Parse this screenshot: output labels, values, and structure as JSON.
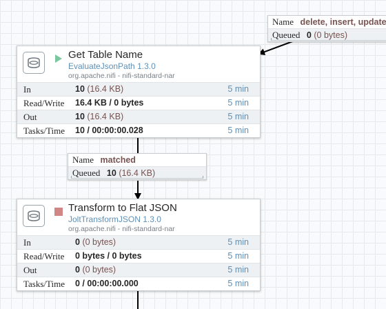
{
  "connections": [
    {
      "name_label": "Name",
      "name": "delete, insert, update",
      "queued_label": "Queued",
      "queued_count": "0",
      "queued_bytes": "(0 bytes)"
    },
    {
      "name_label": "Name",
      "name": "matched",
      "queued_label": "Queued",
      "queued_count": "10",
      "queued_bytes": "(16.4 KB)"
    }
  ],
  "processors": [
    {
      "name": "Get Table Name",
      "type": "EvaluateJsonPath 1.3.0",
      "bundle": "org.apache.nifi - nifi-standard-nar",
      "state_icon": "play-icon",
      "state_color": "#7dc7a0",
      "stats": [
        {
          "label": "In",
          "value": "10",
          "detail": "(16.4 KB)",
          "time": "5 min"
        },
        {
          "label": "Read/Write",
          "value": "16.4 KB / 0 bytes",
          "detail": "",
          "time": "5 min"
        },
        {
          "label": "Out",
          "value": "10",
          "detail": "(16.4 KB)",
          "time": "5 min"
        },
        {
          "label": "Tasks/Time",
          "value": "10 / 00:00:00.028",
          "detail": "",
          "time": "5 min"
        }
      ]
    },
    {
      "name": "Transform to Flat JSON",
      "type": "JoltTransformJSON 1.3.0",
      "bundle": "org.apache.nifi - nifi-standard-nar",
      "state_icon": "stop-icon",
      "state_color": "#d18686",
      "stats": [
        {
          "label": "In",
          "value": "0",
          "detail": "(0 bytes)",
          "time": "5 min"
        },
        {
          "label": "Read/Write",
          "value": "0 bytes / 0 bytes",
          "detail": "",
          "time": "5 min"
        },
        {
          "label": "Out",
          "value": "0",
          "detail": "(0 bytes)",
          "time": "5 min"
        },
        {
          "label": "Tasks/Time",
          "value": "0 / 00:00:00.000",
          "detail": "",
          "time": "5 min"
        }
      ]
    }
  ]
}
